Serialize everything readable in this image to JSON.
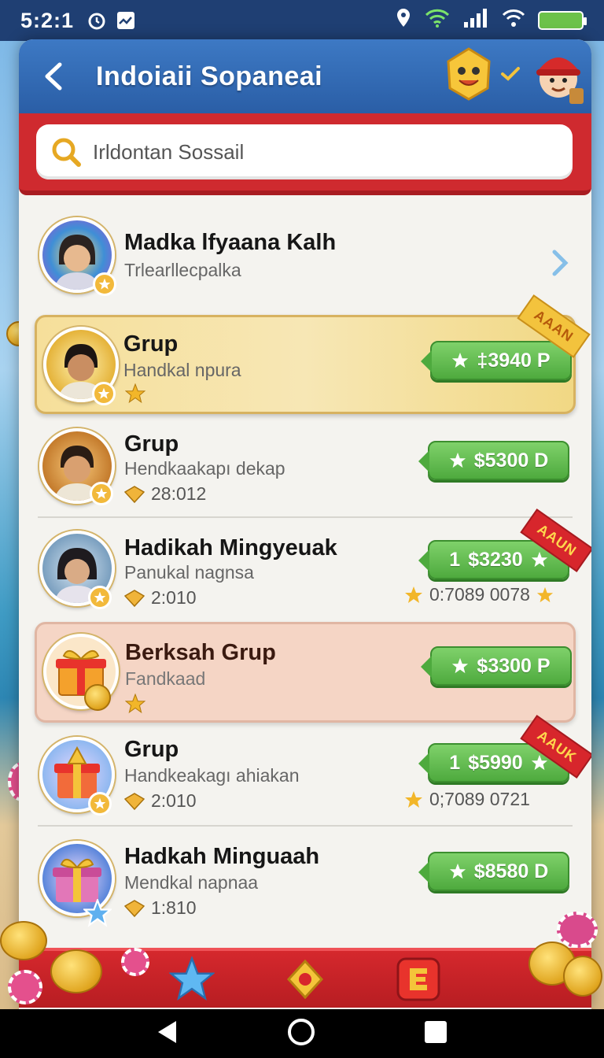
{
  "status_bar": {
    "time": "5:2:1"
  },
  "header": {
    "title": "Indoiaii Sopaneai"
  },
  "search": {
    "placeholder": "Irldontan Sossail"
  },
  "rows": [
    {
      "name": "Madka lfyaana Kalh",
      "sub": "Trlearllecpalka"
    },
    {
      "name": "Grup",
      "sub": "Handkal npura",
      "reward": "‡3940 P",
      "ribbon": "AAAN"
    },
    {
      "name": "Grup",
      "sub": "Hendkaakapı dekap",
      "meta": "28:012",
      "reward": "$5300 D"
    },
    {
      "name": "Hadikah Mingyeuak",
      "sub": "Panukal nagnsa",
      "meta": "2:010",
      "reward_prefix": "1",
      "reward": "$3230",
      "meta_right": "0:7089 0078",
      "ribbon": "AAUN"
    },
    {
      "name": "Berksah Grup",
      "sub": "Fandkaad",
      "reward": "$3300 P"
    },
    {
      "name": "Grup",
      "sub": "Handkeakagı ahiakan",
      "meta": "2:010",
      "reward_prefix": "1",
      "reward": "$5990",
      "meta_right": "0;7089 0721",
      "ribbon": "AAUK"
    },
    {
      "name": "Hadkah Minguaah",
      "sub": "Mendkal napnaa",
      "meta": "1:810",
      "reward": "$8580 D"
    }
  ],
  "colors": {
    "header_blue": "#2a5ea6",
    "accent_red": "#cf2a2f",
    "reward_green": "#4eaa3e",
    "gold": "#f2b93b"
  },
  "icons": [
    "back-icon",
    "search-icon",
    "chevron-right-icon",
    "star-icon",
    "coin-icon",
    "gift-icon",
    "map-pin-icon",
    "home-icon"
  ]
}
